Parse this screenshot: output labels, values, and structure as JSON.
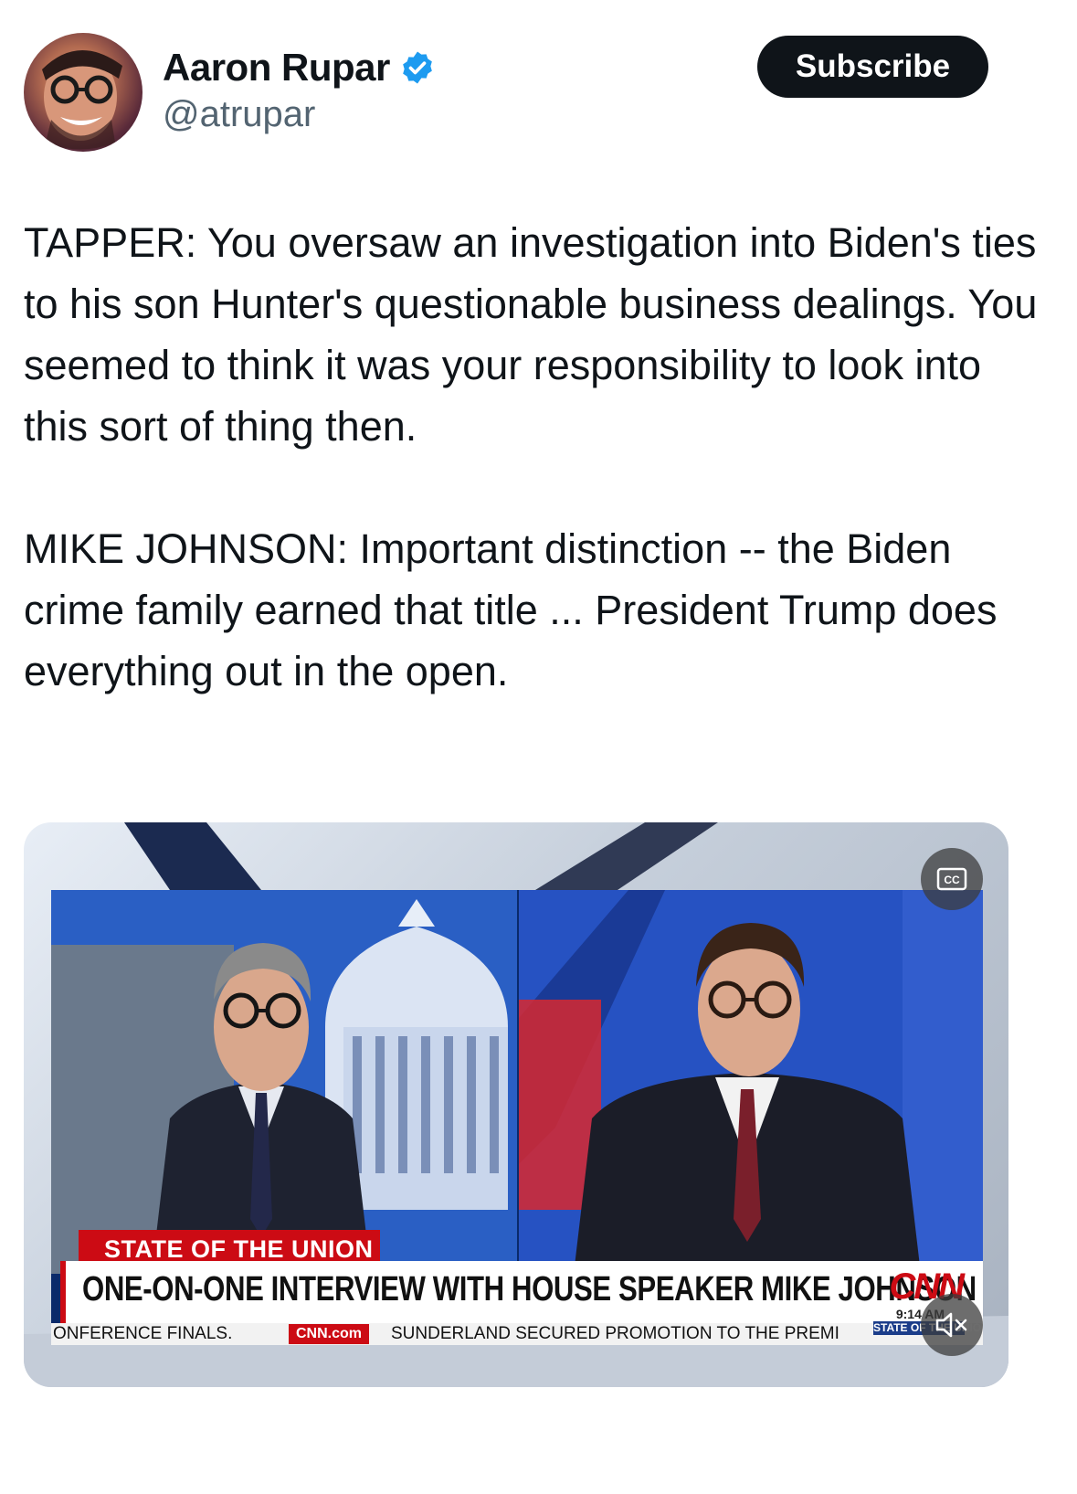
{
  "author": {
    "name": "Aaron Rupar",
    "handle": "@atrupar",
    "verified_icon": "verified-badge-icon",
    "verified_color": "#1d9bf0"
  },
  "subscribe_label": "Subscribe",
  "tweet": {
    "paragraph1": "TAPPER: You oversaw an investigation into Biden's ties to his son Hunter's questionable business dealings. You seemed to think it was your responsibility to look into this sort of thing then.",
    "paragraph2": "MIKE JOHNSON: Important distinction -- the Biden crime family earned that title ... President Trump does everything out in the open."
  },
  "video": {
    "show_label": "STATE OF THE UNION",
    "headline": "ONE-ON-ONE INTERVIEW WITH HOUSE SPEAKER MIKE JOHNSON",
    "network_logo": "CNN",
    "time": "9:14 AM",
    "ticker_left": "ONFERENCE FINALS.",
    "ticker_site": "CNN.com",
    "ticker_right": "SUNDERLAND SECURED PROMOTION TO THE PREMI",
    "corner_bug": "STATE OF THE UNION",
    "cc_label": "CC",
    "accent_red": "#cc0b14"
  }
}
